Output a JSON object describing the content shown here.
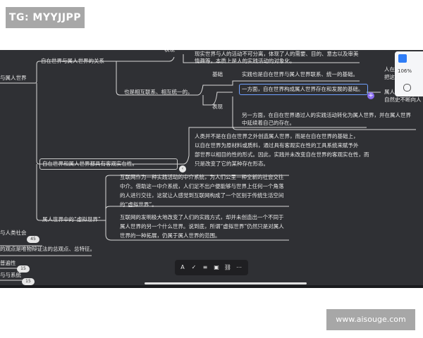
{
  "watermarks": {
    "top_left": "TG: MYYJJPP",
    "bottom_right": "www.aisouge.com"
  },
  "toolbar": {
    "zoom": "106%"
  },
  "mindmap": {
    "nodes": {
      "biaoxian_top": "表现",
      "xianshi_fragment": "现实世界与人的活动不可分离，体现了人的需要、目的、意志以及审美",
      "qingqu": "情趣等，本质上是人的实践活动的对象化。",
      "ziran_guanxi": "自在世界与属人世界的关系",
      "left_partial": "与属人世界",
      "jichu": "基础",
      "shijian_jichu": "实践也是自在世界与属人世界联系、统一的基础。",
      "ye_shi": "也是相互联系、相互统一的。",
      "biaoxian_mid": "表现",
      "yifangmian": "一方面，自在世界构成属人世界存在和发展的基础。",
      "lingyifangmian_1": "另一方面，在自在世界通过人的实践活动转化为属人世界，并在属人世界",
      "lingyifangmian_2": "中延续着自己的存在。",
      "right_1": "人在实践",
      "right_2": "把这种本",
      "right_3": "属人世界",
      "right_4": "自然史不断向人",
      "para1_1": "人类并不是在自在世界之外创造属人世界，而是在自在世界的基础上，",
      "para1_2": "以自在世界为原材料或质料，通过具有客观实在性的工具系统来赋予外",
      "para1_3": "部世界以相目的性的形式。因此，实践并未改变自在世界的客观实在性，而",
      "para1_4": "只是改变了它的某种存在形态。",
      "keguan": "自在世界和属人世界都具有客观实在性。",
      "para2_1": "互联网作为一种实践活动的中介系统，为人们公里一种全新的社会交往",
      "para2_2": "中介。借助这一中介系统，人们足不出户便能够与世界上任何一个角落",
      "para2_3": "的人进行交往，这就让人感觉到互联网构成了一个区别于传统生活空间",
      "para2_4": "的“虚拟世界”。",
      "xuni": "属人世界中的“虚拟世界”",
      "para3_1": "互联网的发明极大地改变了人们的实践方式，却并未创造出一个不同于",
      "para3_2": "属人世界的另一个什么世界。说到底，所谓“虚拟世界”仍然只是对属人",
      "para3_3": "世界的一种拓展，仍属于属人世界的范围。",
      "ren_lei": "与人类社会",
      "guandian": "的观点是唯物辩证法的总观点、总特征。",
      "pubian": "普遍性",
      "yu_xi": "与与系统"
    },
    "badges": {
      "b45": "45",
      "b15a": "15",
      "b15b": "15"
    }
  }
}
